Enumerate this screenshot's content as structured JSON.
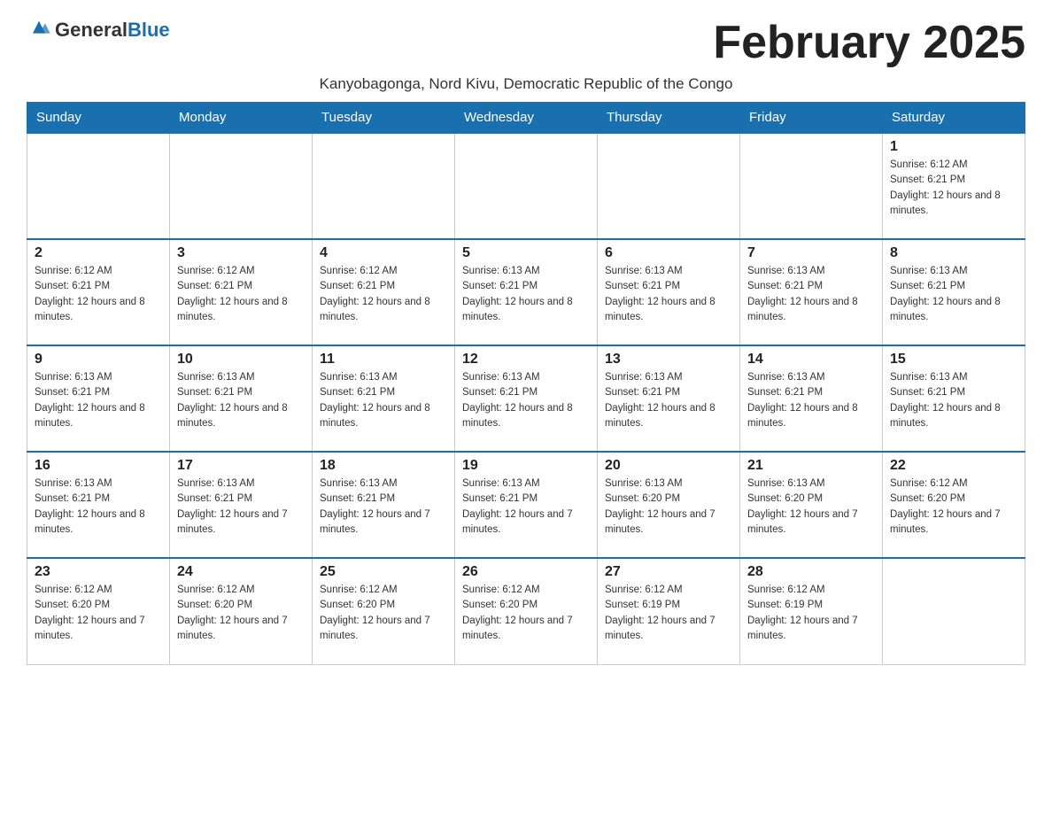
{
  "header": {
    "logo_general": "General",
    "logo_blue": "Blue",
    "month_title": "February 2025",
    "subtitle": "Kanyobagonga, Nord Kivu, Democratic Republic of the Congo"
  },
  "weekdays": [
    "Sunday",
    "Monday",
    "Tuesday",
    "Wednesday",
    "Thursday",
    "Friday",
    "Saturday"
  ],
  "weeks": [
    [
      {
        "day": "",
        "info": ""
      },
      {
        "day": "",
        "info": ""
      },
      {
        "day": "",
        "info": ""
      },
      {
        "day": "",
        "info": ""
      },
      {
        "day": "",
        "info": ""
      },
      {
        "day": "",
        "info": ""
      },
      {
        "day": "1",
        "info": "Sunrise: 6:12 AM\nSunset: 6:21 PM\nDaylight: 12 hours and 8 minutes."
      }
    ],
    [
      {
        "day": "2",
        "info": "Sunrise: 6:12 AM\nSunset: 6:21 PM\nDaylight: 12 hours and 8 minutes."
      },
      {
        "day": "3",
        "info": "Sunrise: 6:12 AM\nSunset: 6:21 PM\nDaylight: 12 hours and 8 minutes."
      },
      {
        "day": "4",
        "info": "Sunrise: 6:12 AM\nSunset: 6:21 PM\nDaylight: 12 hours and 8 minutes."
      },
      {
        "day": "5",
        "info": "Sunrise: 6:13 AM\nSunset: 6:21 PM\nDaylight: 12 hours and 8 minutes."
      },
      {
        "day": "6",
        "info": "Sunrise: 6:13 AM\nSunset: 6:21 PM\nDaylight: 12 hours and 8 minutes."
      },
      {
        "day": "7",
        "info": "Sunrise: 6:13 AM\nSunset: 6:21 PM\nDaylight: 12 hours and 8 minutes."
      },
      {
        "day": "8",
        "info": "Sunrise: 6:13 AM\nSunset: 6:21 PM\nDaylight: 12 hours and 8 minutes."
      }
    ],
    [
      {
        "day": "9",
        "info": "Sunrise: 6:13 AM\nSunset: 6:21 PM\nDaylight: 12 hours and 8 minutes."
      },
      {
        "day": "10",
        "info": "Sunrise: 6:13 AM\nSunset: 6:21 PM\nDaylight: 12 hours and 8 minutes."
      },
      {
        "day": "11",
        "info": "Sunrise: 6:13 AM\nSunset: 6:21 PM\nDaylight: 12 hours and 8 minutes."
      },
      {
        "day": "12",
        "info": "Sunrise: 6:13 AM\nSunset: 6:21 PM\nDaylight: 12 hours and 8 minutes."
      },
      {
        "day": "13",
        "info": "Sunrise: 6:13 AM\nSunset: 6:21 PM\nDaylight: 12 hours and 8 minutes."
      },
      {
        "day": "14",
        "info": "Sunrise: 6:13 AM\nSunset: 6:21 PM\nDaylight: 12 hours and 8 minutes."
      },
      {
        "day": "15",
        "info": "Sunrise: 6:13 AM\nSunset: 6:21 PM\nDaylight: 12 hours and 8 minutes."
      }
    ],
    [
      {
        "day": "16",
        "info": "Sunrise: 6:13 AM\nSunset: 6:21 PM\nDaylight: 12 hours and 8 minutes."
      },
      {
        "day": "17",
        "info": "Sunrise: 6:13 AM\nSunset: 6:21 PM\nDaylight: 12 hours and 7 minutes."
      },
      {
        "day": "18",
        "info": "Sunrise: 6:13 AM\nSunset: 6:21 PM\nDaylight: 12 hours and 7 minutes."
      },
      {
        "day": "19",
        "info": "Sunrise: 6:13 AM\nSunset: 6:21 PM\nDaylight: 12 hours and 7 minutes."
      },
      {
        "day": "20",
        "info": "Sunrise: 6:13 AM\nSunset: 6:20 PM\nDaylight: 12 hours and 7 minutes."
      },
      {
        "day": "21",
        "info": "Sunrise: 6:13 AM\nSunset: 6:20 PM\nDaylight: 12 hours and 7 minutes."
      },
      {
        "day": "22",
        "info": "Sunrise: 6:12 AM\nSunset: 6:20 PM\nDaylight: 12 hours and 7 minutes."
      }
    ],
    [
      {
        "day": "23",
        "info": "Sunrise: 6:12 AM\nSunset: 6:20 PM\nDaylight: 12 hours and 7 minutes."
      },
      {
        "day": "24",
        "info": "Sunrise: 6:12 AM\nSunset: 6:20 PM\nDaylight: 12 hours and 7 minutes."
      },
      {
        "day": "25",
        "info": "Sunrise: 6:12 AM\nSunset: 6:20 PM\nDaylight: 12 hours and 7 minutes."
      },
      {
        "day": "26",
        "info": "Sunrise: 6:12 AM\nSunset: 6:20 PM\nDaylight: 12 hours and 7 minutes."
      },
      {
        "day": "27",
        "info": "Sunrise: 6:12 AM\nSunset: 6:19 PM\nDaylight: 12 hours and 7 minutes."
      },
      {
        "day": "28",
        "info": "Sunrise: 6:12 AM\nSunset: 6:19 PM\nDaylight: 12 hours and 7 minutes."
      },
      {
        "day": "",
        "info": ""
      }
    ]
  ]
}
